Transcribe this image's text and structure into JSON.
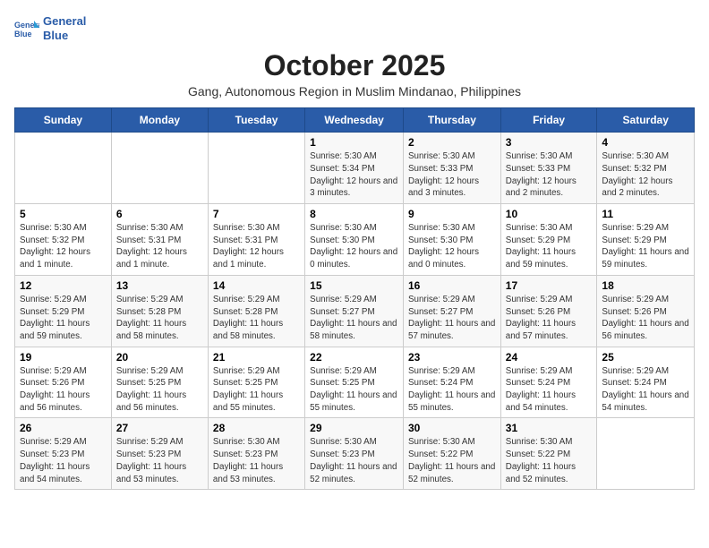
{
  "logo": {
    "line1": "General",
    "line2": "Blue"
  },
  "title": "October 2025",
  "subtitle": "Gang, Autonomous Region in Muslim Mindanao, Philippines",
  "weekdays": [
    "Sunday",
    "Monday",
    "Tuesday",
    "Wednesday",
    "Thursday",
    "Friday",
    "Saturday"
  ],
  "weeks": [
    [
      {
        "day": "",
        "info": ""
      },
      {
        "day": "",
        "info": ""
      },
      {
        "day": "",
        "info": ""
      },
      {
        "day": "1",
        "info": "Sunrise: 5:30 AM\nSunset: 5:34 PM\nDaylight: 12 hours and 3 minutes."
      },
      {
        "day": "2",
        "info": "Sunrise: 5:30 AM\nSunset: 5:33 PM\nDaylight: 12 hours and 3 minutes."
      },
      {
        "day": "3",
        "info": "Sunrise: 5:30 AM\nSunset: 5:33 PM\nDaylight: 12 hours and 2 minutes."
      },
      {
        "day": "4",
        "info": "Sunrise: 5:30 AM\nSunset: 5:32 PM\nDaylight: 12 hours and 2 minutes."
      }
    ],
    [
      {
        "day": "5",
        "info": "Sunrise: 5:30 AM\nSunset: 5:32 PM\nDaylight: 12 hours and 1 minute."
      },
      {
        "day": "6",
        "info": "Sunrise: 5:30 AM\nSunset: 5:31 PM\nDaylight: 12 hours and 1 minute."
      },
      {
        "day": "7",
        "info": "Sunrise: 5:30 AM\nSunset: 5:31 PM\nDaylight: 12 hours and 1 minute."
      },
      {
        "day": "8",
        "info": "Sunrise: 5:30 AM\nSunset: 5:30 PM\nDaylight: 12 hours and 0 minutes."
      },
      {
        "day": "9",
        "info": "Sunrise: 5:30 AM\nSunset: 5:30 PM\nDaylight: 12 hours and 0 minutes."
      },
      {
        "day": "10",
        "info": "Sunrise: 5:30 AM\nSunset: 5:29 PM\nDaylight: 11 hours and 59 minutes."
      },
      {
        "day": "11",
        "info": "Sunrise: 5:29 AM\nSunset: 5:29 PM\nDaylight: 11 hours and 59 minutes."
      }
    ],
    [
      {
        "day": "12",
        "info": "Sunrise: 5:29 AM\nSunset: 5:29 PM\nDaylight: 11 hours and 59 minutes."
      },
      {
        "day": "13",
        "info": "Sunrise: 5:29 AM\nSunset: 5:28 PM\nDaylight: 11 hours and 58 minutes."
      },
      {
        "day": "14",
        "info": "Sunrise: 5:29 AM\nSunset: 5:28 PM\nDaylight: 11 hours and 58 minutes."
      },
      {
        "day": "15",
        "info": "Sunrise: 5:29 AM\nSunset: 5:27 PM\nDaylight: 11 hours and 58 minutes."
      },
      {
        "day": "16",
        "info": "Sunrise: 5:29 AM\nSunset: 5:27 PM\nDaylight: 11 hours and 57 minutes."
      },
      {
        "day": "17",
        "info": "Sunrise: 5:29 AM\nSunset: 5:26 PM\nDaylight: 11 hours and 57 minutes."
      },
      {
        "day": "18",
        "info": "Sunrise: 5:29 AM\nSunset: 5:26 PM\nDaylight: 11 hours and 56 minutes."
      }
    ],
    [
      {
        "day": "19",
        "info": "Sunrise: 5:29 AM\nSunset: 5:26 PM\nDaylight: 11 hours and 56 minutes."
      },
      {
        "day": "20",
        "info": "Sunrise: 5:29 AM\nSunset: 5:25 PM\nDaylight: 11 hours and 56 minutes."
      },
      {
        "day": "21",
        "info": "Sunrise: 5:29 AM\nSunset: 5:25 PM\nDaylight: 11 hours and 55 minutes."
      },
      {
        "day": "22",
        "info": "Sunrise: 5:29 AM\nSunset: 5:25 PM\nDaylight: 11 hours and 55 minutes."
      },
      {
        "day": "23",
        "info": "Sunrise: 5:29 AM\nSunset: 5:24 PM\nDaylight: 11 hours and 55 minutes."
      },
      {
        "day": "24",
        "info": "Sunrise: 5:29 AM\nSunset: 5:24 PM\nDaylight: 11 hours and 54 minutes."
      },
      {
        "day": "25",
        "info": "Sunrise: 5:29 AM\nSunset: 5:24 PM\nDaylight: 11 hours and 54 minutes."
      }
    ],
    [
      {
        "day": "26",
        "info": "Sunrise: 5:29 AM\nSunset: 5:23 PM\nDaylight: 11 hours and 54 minutes."
      },
      {
        "day": "27",
        "info": "Sunrise: 5:29 AM\nSunset: 5:23 PM\nDaylight: 11 hours and 53 minutes."
      },
      {
        "day": "28",
        "info": "Sunrise: 5:30 AM\nSunset: 5:23 PM\nDaylight: 11 hours and 53 minutes."
      },
      {
        "day": "29",
        "info": "Sunrise: 5:30 AM\nSunset: 5:23 PM\nDaylight: 11 hours and 52 minutes."
      },
      {
        "day": "30",
        "info": "Sunrise: 5:30 AM\nSunset: 5:22 PM\nDaylight: 11 hours and 52 minutes."
      },
      {
        "day": "31",
        "info": "Sunrise: 5:30 AM\nSunset: 5:22 PM\nDaylight: 11 hours and 52 minutes."
      },
      {
        "day": "",
        "info": ""
      }
    ]
  ]
}
